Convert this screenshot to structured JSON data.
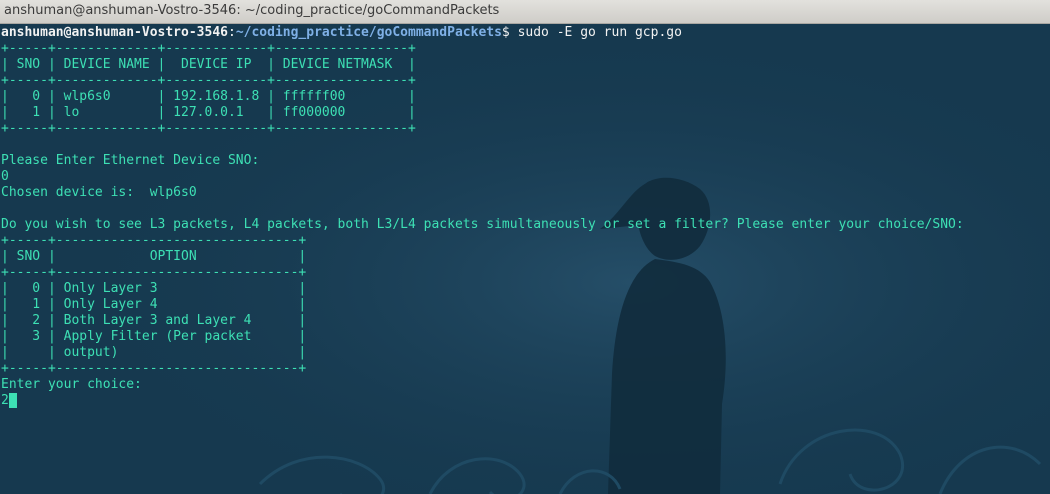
{
  "window": {
    "title": "anshuman@anshuman-Vostro-3546: ~/coding_practice/goCommandPackets"
  },
  "prompt": {
    "user_host": "anshuman@anshuman-Vostro-3546",
    "separator": ":",
    "path": "~/coding_practice/goCommandPackets",
    "symbol": "$ ",
    "command": "sudo -E go run gcp.go"
  },
  "device_table": {
    "border": "+-----+-------------+-------------+-----------------+",
    "header": "| SNO | DEVICE NAME |  DEVICE IP  | DEVICE NETMASK  |",
    "rows": [
      "|   0 | wlp6s0      | 192.168.1.8 | ffffff00        |",
      "|   1 | lo          | 127.0.0.1   | ff000000        |"
    ]
  },
  "device_prompt": "Please Enter Ethernet Device SNO:",
  "device_input": "0",
  "chosen_device": "Chosen device is:  wlp6s0",
  "choice_question": "Do you wish to see L3 packets, L4 packets, both L3/L4 packets simultaneously or set a filter? Please enter your choice/SNO:",
  "option_table": {
    "border": "+-----+-------------------------------+",
    "header": "| SNO |            OPTION             |",
    "rows": [
      "|   0 | Only Layer 3                  |",
      "|   1 | Only Layer 4                  |",
      "|   2 | Both Layer 3 and Layer 4      |",
      "|   3 | Apply Filter (Per packet      |",
      "|     | output)                       |"
    ]
  },
  "choice_prompt": "Enter your choice:",
  "choice_input": "2",
  "colors": {
    "background": "#16394f",
    "output_text": "#3de0b4",
    "prompt_path": "#7fb0e6",
    "cursor": "#3de0b4"
  }
}
